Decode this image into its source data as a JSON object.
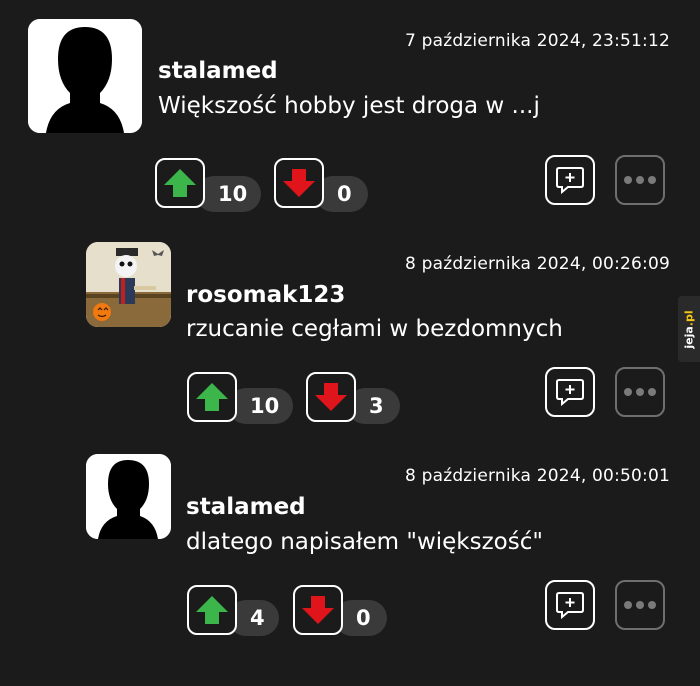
{
  "comments": [
    {
      "date": "7 października 2024, 23:51:12",
      "username": "stalamed",
      "text": "Większość hobby jest droga w ...j",
      "upvotes": "10",
      "downvotes": "0",
      "avatar": "silhouette-avatar"
    },
    {
      "date": "8 października 2024, 00:26:09",
      "username": "rosomak123",
      "text": "rzucanie cegłami w bezdomnych",
      "upvotes": "10",
      "downvotes": "3",
      "avatar": "skeleton-avatar"
    },
    {
      "date": "8 października 2024, 00:50:01",
      "username": "stalamed",
      "text": "dlatego napisałem \"większość\"",
      "upvotes": "4",
      "downvotes": "0",
      "avatar": "silhouette-avatar"
    }
  ],
  "icons": {
    "upvote": "up-arrow-icon",
    "downvote": "down-arrow-icon",
    "reply": "reply-bubble-icon",
    "more": "more-dots-icon"
  },
  "colors": {
    "background": "#1b1b1b",
    "upvote": "#3cb54a",
    "downvote": "#e0151b",
    "count_bg": "#3a3a3a"
  },
  "watermark": {
    "name": "jeja",
    "tld": ".pl"
  }
}
